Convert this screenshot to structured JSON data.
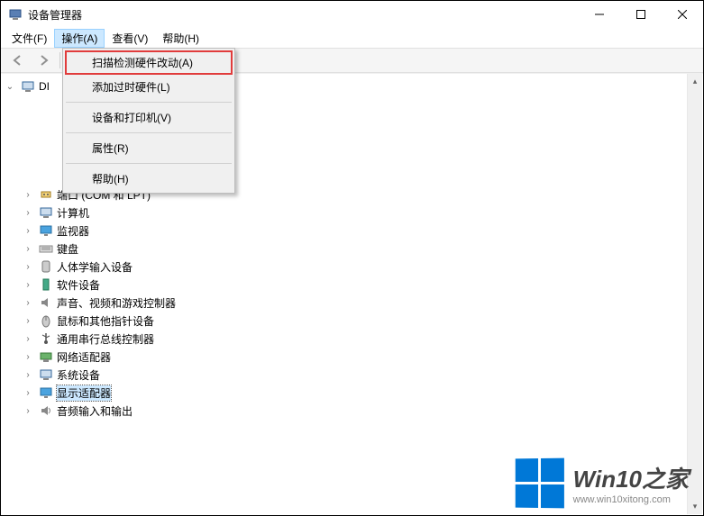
{
  "window": {
    "title": "设备管理器"
  },
  "menubar": {
    "file": "文件(F)",
    "action": "操作(A)",
    "view": "查看(V)",
    "help": "帮助(H)"
  },
  "dropdown": {
    "scan": "扫描检测硬件改动(A)",
    "add_legacy": "添加过时硬件(L)",
    "devices_printers": "设备和打印机(V)",
    "properties": "属性(R)",
    "help": "帮助(H)"
  },
  "tree": {
    "root": "DI",
    "items": [
      "端口 (COM 和 LPT)",
      "计算机",
      "监视器",
      "键盘",
      "人体学输入设备",
      "软件设备",
      "声音、视频和游戏控制器",
      "鼠标和其他指针设备",
      "通用串行总线控制器",
      "网络适配器",
      "系统设备",
      "显示适配器",
      "音频输入和输出"
    ]
  },
  "watermark": {
    "title": "Win10之家",
    "url": "www.win10xitong.com"
  }
}
